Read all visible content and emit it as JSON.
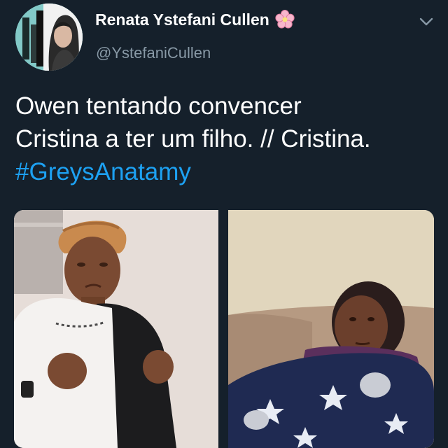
{
  "tweet": {
    "author": {
      "display_name": "Renata Ystefani Cullen",
      "handle": "@YstefaniCullen",
      "name_emoji_icon": "cherry-blossom-icon",
      "avatar_icon": "profile-avatar"
    },
    "menu_icon": "chevron-down-icon",
    "text_lines": [
      "Owen tentando convencer",
      "Cristina a ter um filho. // Cristina."
    ],
    "hashtag": "#GreysAnatamy",
    "media": {
      "left_image_icon": "photo-woman-pleading",
      "right_image_icon": "photo-woman-on-couch"
    }
  },
  "colors": {
    "background": "#15202b",
    "text": "#ffffff",
    "secondary_text": "#8899a6",
    "link": "#1da1f2"
  }
}
